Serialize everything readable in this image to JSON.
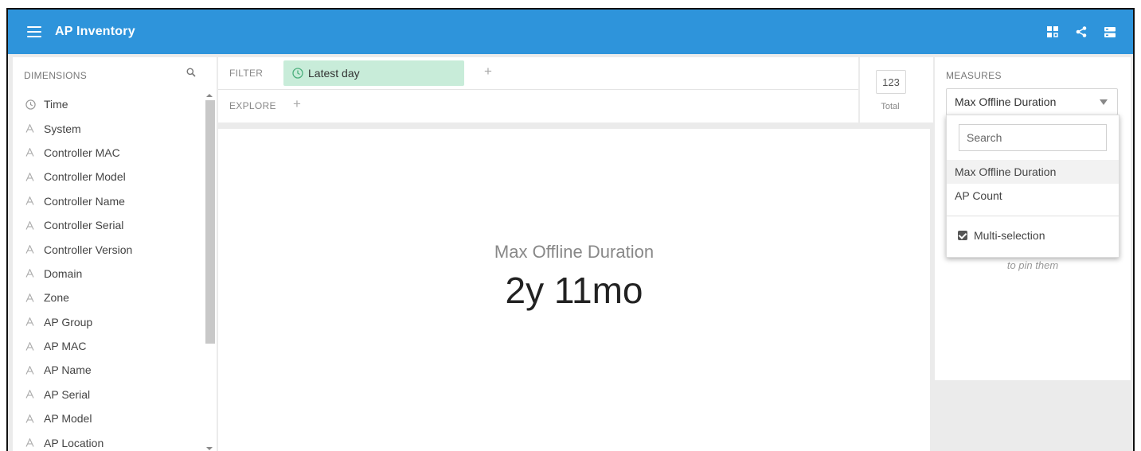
{
  "app": {
    "title": "AP Inventory"
  },
  "header_icons": [
    "dashboard-icon",
    "share-icon",
    "settings-icon"
  ],
  "colors": {
    "header": "#2e94db",
    "filter_chip": "#c8ecd9"
  },
  "dimensions": {
    "header": "DIMENSIONS",
    "items": [
      {
        "label": "Time",
        "icon": "clock-icon"
      },
      {
        "label": "System",
        "icon": "text-dimension-icon"
      },
      {
        "label": "Controller MAC",
        "icon": "text-dimension-icon"
      },
      {
        "label": "Controller Model",
        "icon": "text-dimension-icon"
      },
      {
        "label": "Controller Name",
        "icon": "text-dimension-icon"
      },
      {
        "label": "Controller Serial",
        "icon": "text-dimension-icon"
      },
      {
        "label": "Controller Version",
        "icon": "text-dimension-icon"
      },
      {
        "label": "Domain",
        "icon": "text-dimension-icon"
      },
      {
        "label": "Zone",
        "icon": "text-dimension-icon"
      },
      {
        "label": "AP Group",
        "icon": "text-dimension-icon"
      },
      {
        "label": "AP MAC",
        "icon": "text-dimension-icon"
      },
      {
        "label": "AP Name",
        "icon": "text-dimension-icon"
      },
      {
        "label": "AP Serial",
        "icon": "text-dimension-icon"
      },
      {
        "label": "AP Model",
        "icon": "text-dimension-icon"
      },
      {
        "label": "AP Location",
        "icon": "text-dimension-icon"
      }
    ]
  },
  "filter": {
    "label": "FILTER",
    "chip": "Latest day",
    "add": "+"
  },
  "explore": {
    "label": "EXPLORE",
    "add": "+"
  },
  "total": {
    "value": "123",
    "label": "Total"
  },
  "main": {
    "metric_name": "Max Offline Duration",
    "metric_value": "2y 11mo"
  },
  "measures": {
    "header": "MEASURES",
    "selected": "Max Offline Duration",
    "pin_hint": "to pin them",
    "dropdown": {
      "search_placeholder": "Search",
      "options": [
        "Max Offline Duration",
        "AP Count"
      ],
      "multi_selection": "Multi-selection"
    }
  }
}
